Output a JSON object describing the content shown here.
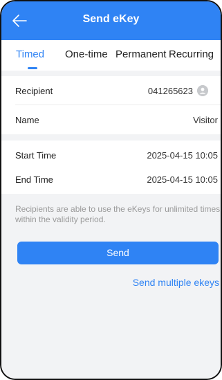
{
  "header": {
    "title": "Send eKey",
    "back_icon": "back-arrow-icon"
  },
  "tabs": [
    {
      "label": "Timed",
      "active": true
    },
    {
      "label": "One-time",
      "active": false
    },
    {
      "label": "Permanent",
      "active": false
    },
    {
      "label": "Recurring",
      "active": false
    }
  ],
  "form": {
    "recipient_label": "Recipient",
    "recipient_value": "041265623",
    "contact_icon": "contact-person-icon",
    "name_label": "Name",
    "name_value": "Visitor",
    "start_label": "Start Time",
    "start_value": "2025-04-15 10:05",
    "end_label": "End Time",
    "end_value": "2025-04-15 10:05"
  },
  "note": "Recipients are able to use the eKeys for unlimited times within the validity period.",
  "actions": {
    "send_label": "Send",
    "multi_label": "Send multiple ekeys"
  },
  "colors": {
    "accent": "#2f83f4",
    "background": "#f2f3f5",
    "note_text": "#9a9a9a"
  }
}
